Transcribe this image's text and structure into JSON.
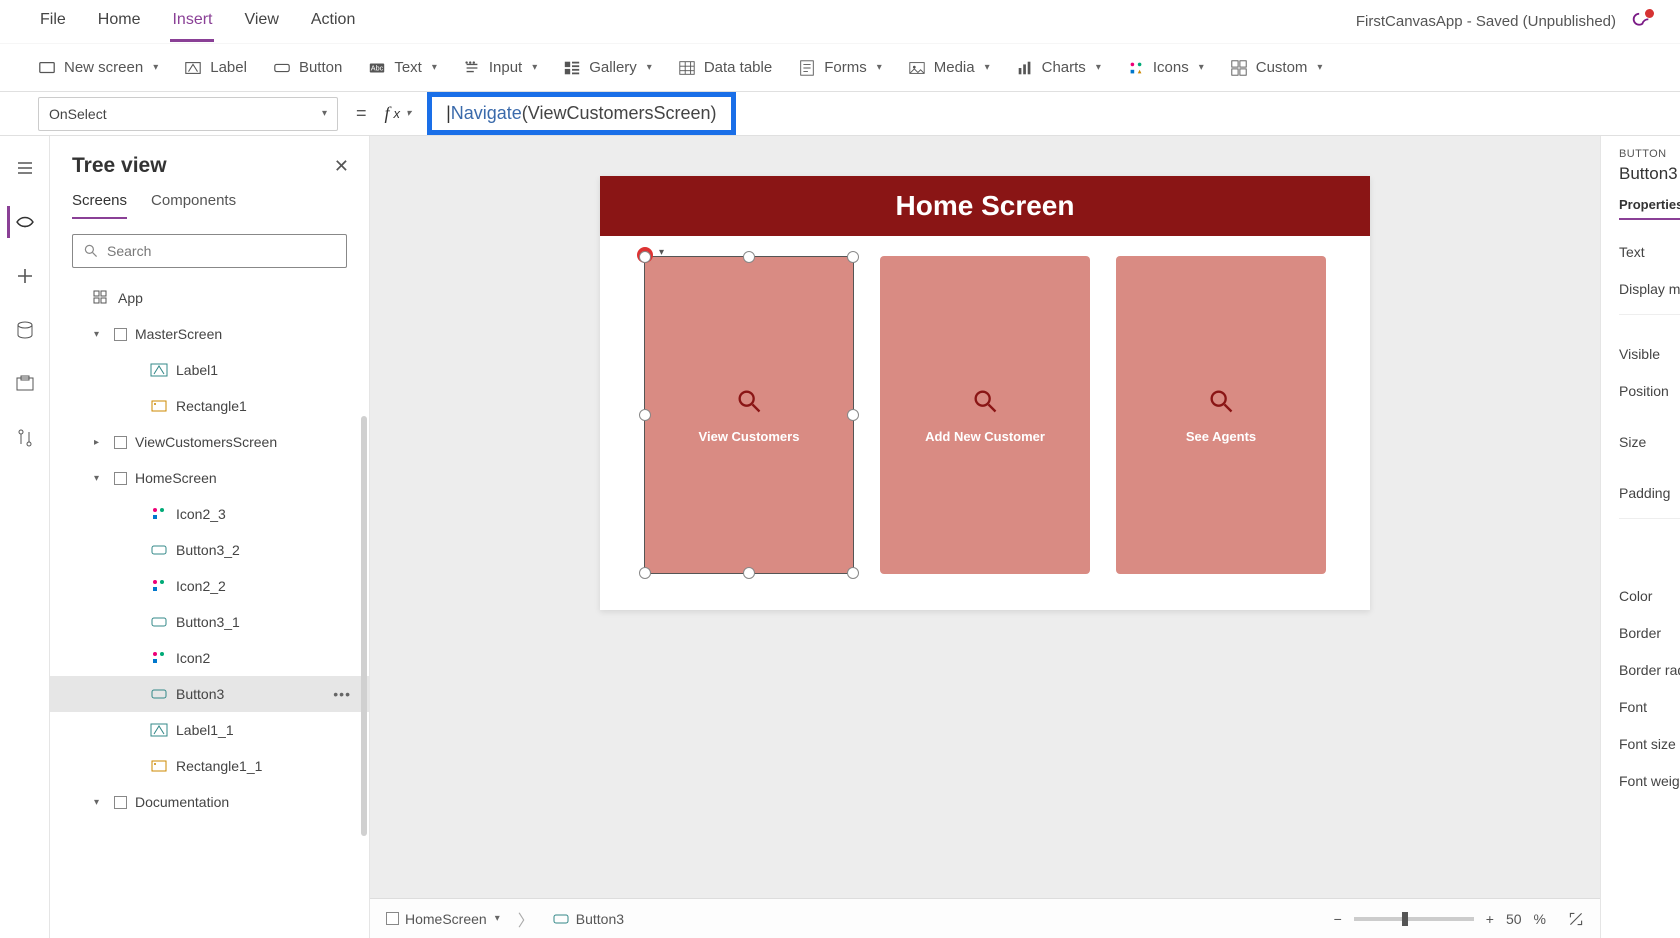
{
  "menu": {
    "items": [
      "File",
      "Home",
      "Insert",
      "View",
      "Action"
    ],
    "active": "Insert"
  },
  "title_bar": {
    "text": "FirstCanvasApp - Saved (Unpublished)"
  },
  "ribbon": {
    "new_screen": "New screen",
    "label": "Label",
    "button": "Button",
    "text": "Text",
    "input": "Input",
    "gallery": "Gallery",
    "data_table": "Data table",
    "forms": "Forms",
    "media": "Media",
    "charts": "Charts",
    "icons": "Icons",
    "custom": "Custom"
  },
  "formula": {
    "property": "OnSelect",
    "fn": "Navigate",
    "arg": "ViewCustomersScreen"
  },
  "tree": {
    "title": "Tree view",
    "tabs": {
      "screens": "Screens",
      "components": "Components"
    },
    "search_placeholder": "Search",
    "app": "App",
    "nodes": {
      "master": "MasterScreen",
      "label1": "Label1",
      "rect1": "Rectangle1",
      "viewcust": "ViewCustomersScreen",
      "home": "HomeScreen",
      "icon2_3": "Icon2_3",
      "button3_2": "Button3_2",
      "icon2_2": "Icon2_2",
      "button3_1": "Button3_1",
      "icon2": "Icon2",
      "button3": "Button3",
      "label1_1": "Label1_1",
      "rect1_1": "Rectangle1_1",
      "documentation": "Documentation"
    }
  },
  "canvas": {
    "header": "Home Screen",
    "tiles": {
      "view_customers": "View Customers",
      "add_customer": "Add New Customer",
      "see_agents": "See Agents"
    }
  },
  "statusbar": {
    "breadcrumb_screen": "HomeScreen",
    "breadcrumb_control": "Button3",
    "zoom_value": "50",
    "zoom_unit": "%"
  },
  "props": {
    "type_label": "BUTTON",
    "name": "Button3",
    "tab": "Properties",
    "rows": [
      "Text",
      "Display mod",
      "Visible",
      "Position",
      "Size",
      "Padding",
      "Color",
      "Border",
      "Border radiu",
      "Font",
      "Font size",
      "Font weight"
    ]
  }
}
